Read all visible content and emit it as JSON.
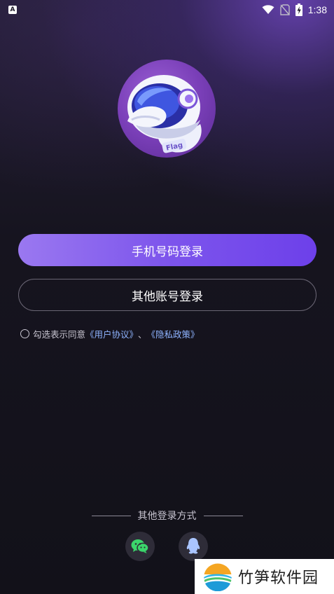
{
  "status_bar": {
    "notification_icon": "accessibility-notification-icon",
    "notification_glyph": "A",
    "icons": [
      "wifi-icon",
      "no-sim-icon",
      "battery-charging-icon"
    ],
    "time": "1:38"
  },
  "logo": {
    "icon": "astronaut-logo-icon",
    "badge_text": "Flag"
  },
  "buttons": {
    "phone_login": "手机号码登录",
    "other_account_login": "其他账号登录"
  },
  "agreement": {
    "checked": false,
    "prefix": "勾选表示同意",
    "user_agreement_link": "《用户协议》",
    "separator": "、",
    "privacy_link": "《隐私政策》"
  },
  "other_login": {
    "label": "其他登录方式",
    "methods": [
      {
        "icon": "wechat-icon",
        "color": "#3bd66b"
      },
      {
        "icon": "qq-icon",
        "color": "#a9c4ff"
      }
    ]
  },
  "watermark": {
    "text": "竹笋软件园"
  },
  "colors": {
    "primary_button_start": "#9a78f0",
    "primary_button_end": "#6d40ea",
    "link": "#8fb4ff",
    "background": "#16141f"
  }
}
